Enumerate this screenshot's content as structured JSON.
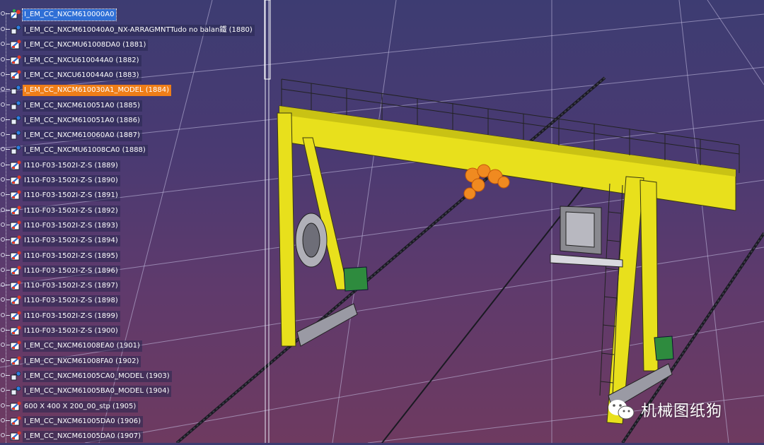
{
  "tree": {
    "root": {
      "label": "I_EM_CC_NXCM610000A0"
    },
    "items": [
      {
        "label": "I_EM_CC_NXCM610040A0_NX-ARRAGMNTTudo no balan鐵 (1880)",
        "icon": "sub-assembly-icon"
      },
      {
        "label": "I_EM_CC_NXCMU61008DA0 (1881)",
        "icon": "part-icon"
      },
      {
        "label": "I_EM_CC_NXCU610044A0 (1882)",
        "icon": "part-icon"
      },
      {
        "label": "I_EM_CC_NXCU610044A0 (1883)",
        "icon": "part-icon"
      },
      {
        "label": "I_EM_CC_NXCM610030A1_MODEL (1884)",
        "icon": "sub-assembly-icon",
        "selected": true
      },
      {
        "label": "I_EM_CC_NXCM610051A0 (1885)",
        "icon": "sub-assembly-icon"
      },
      {
        "label": "I_EM_CC_NXCM610051A0 (1886)",
        "icon": "sub-assembly-icon"
      },
      {
        "label": "I_EM_CC_NXCM610060A0 (1887)",
        "icon": "sub-assembly-icon"
      },
      {
        "label": "I_EM_CC_NXCMU61008CA0 (1888)",
        "icon": "sub-assembly-icon"
      },
      {
        "label": "I110-F03-1502I-Z-S (1889)",
        "icon": "part-icon"
      },
      {
        "label": "I110-F03-1502I-Z-S (1890)",
        "icon": "part-icon"
      },
      {
        "label": "I110-F03-1502I-Z-S (1891)",
        "icon": "part-icon"
      },
      {
        "label": "I110-F03-1502I-Z-S (1892)",
        "icon": "part-icon"
      },
      {
        "label": "I110-F03-1502I-Z-S (1893)",
        "icon": "part-icon"
      },
      {
        "label": "I110-F03-1502I-Z-S (1894)",
        "icon": "part-icon"
      },
      {
        "label": "I110-F03-1502I-Z-S (1895)",
        "icon": "part-icon"
      },
      {
        "label": "I110-F03-1502I-Z-S (1896)",
        "icon": "part-icon"
      },
      {
        "label": "I110-F03-1502I-Z-S (1897)",
        "icon": "part-icon"
      },
      {
        "label": "I110-F03-1502I-Z-S (1898)",
        "icon": "part-icon"
      },
      {
        "label": "I110-F03-1502I-Z-S (1899)",
        "icon": "part-icon"
      },
      {
        "label": "I110-F03-1502I-Z-S (1900)",
        "icon": "part-icon"
      },
      {
        "label": "I_EM_CC_NXCM61008EA0 (1901)",
        "icon": "part-icon"
      },
      {
        "label": "I_EM_CC_NXCM61008FA0 (1902)",
        "icon": "part-icon"
      },
      {
        "label": "I_EM_CC_NXCM61005CA0_MODEL (1903)",
        "icon": "sub-assembly-icon"
      },
      {
        "label": "I_EM_CC_NXCM61005BA0_MODEL (1904)",
        "icon": "sub-assembly-icon"
      },
      {
        "label": "600 X 400 X 200_00_stp (1905)",
        "icon": "part-icon"
      },
      {
        "label": "I_EM_CC_NXCM61005DA0 (1906)",
        "icon": "part-icon"
      },
      {
        "label": "I_EM_CC_NXCM61005DA0 (1907)",
        "icon": "part-icon"
      }
    ]
  },
  "watermark": {
    "text": "机械图纸狗",
    "icon": "wechat-icon"
  },
  "colors": {
    "background_top": "#3d3c72",
    "background_bottom": "#6e3a60",
    "crane_yellow": "#e8e01c",
    "selection_blue": "#2f6fd6",
    "selection_orange": "#ef7e18",
    "motor_green": "#2e8b3e"
  }
}
